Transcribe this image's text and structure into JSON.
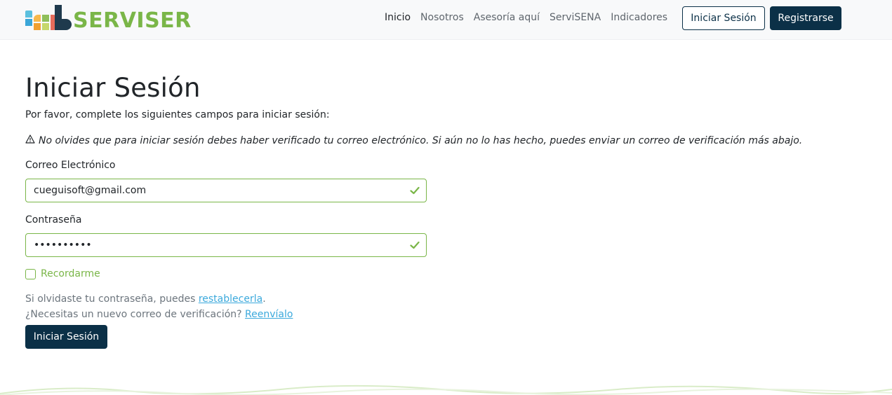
{
  "brand": {
    "name": "SERVISER",
    "accent": "#7ab648",
    "dark": "#0b3047"
  },
  "nav": {
    "links": [
      "Inicio",
      "Nosotros",
      "Asesoría aquí",
      "ServiSENA",
      "Indicadores"
    ],
    "login_label": "Iniciar Sesión",
    "register_label": "Registrarse"
  },
  "form": {
    "title": "Iniciar Sesión",
    "intro": "Por favor, complete los siguientes campos para iniciar sesión:",
    "warning": "No olvides que para iniciar sesión debes haber verificado tu correo electrónico. Si aún no lo has hecho, puedes enviar un correo de verificación más abajo.",
    "email_label": "Correo Electrónico",
    "email_value": "cueguisoft@gmail.com",
    "password_label": "Contraseña",
    "password_value": "••••••••••",
    "remember_label": "Recordarme",
    "forgot_text": "Si olvidaste tu contraseña, puedes ",
    "forgot_link": "restablecerla",
    "forgot_end": ".",
    "resend_text": "¿Necesitas un nuevo correo de verificación? ",
    "resend_link": "Reenvíalo",
    "submit_label": "Iniciar Sesión"
  },
  "icons": {
    "warning": "warning-triangle-icon",
    "valid": "checkmark-icon"
  }
}
